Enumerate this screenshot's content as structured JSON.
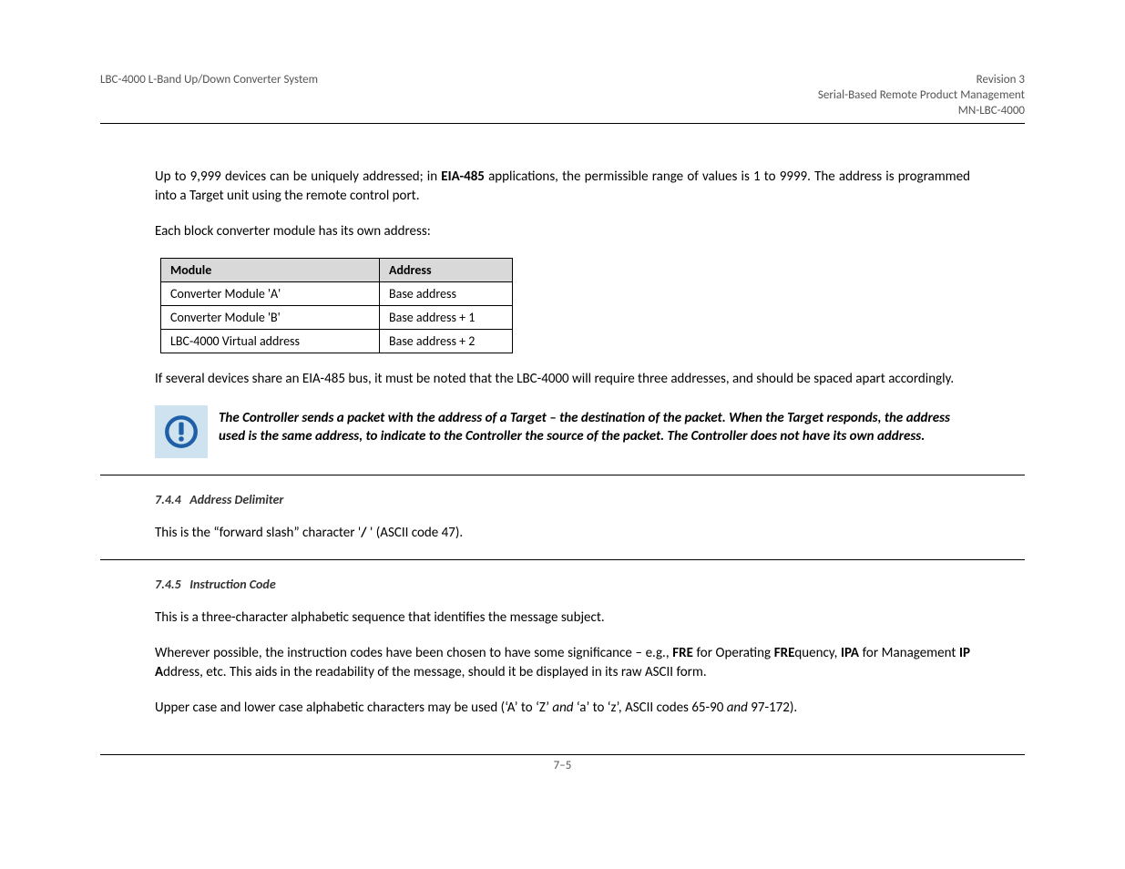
{
  "header": {
    "left": "LBC-4000 L-Band Up/Down Converter System",
    "right_line1": "Revision 3",
    "right_line2": "Serial-Based Remote Product Management",
    "right_line3": "MN-LBC-4000"
  },
  "sec_target": {
    "p1_a": "Up to 9,999 devices can be uniquely addressed; in ",
    "p1_b1": "EIA-485",
    "p1_c": " applications, the permissible range of values is 1 to 9999. The address is programmed into a Target unit using the remote control port.",
    "p2": "Each block converter module has its own address:",
    "table": {
      "h1": "Module",
      "h2": "Address",
      "rows": [
        {
          "c1": "Converter Module 'A'",
          "c2": "Base address"
        },
        {
          "c1": "Converter Module 'B'",
          "c2": "Base address + 1"
        },
        {
          "c1": "LBC-4000 Virtual address",
          "c2": "Base address + 2"
        }
      ]
    },
    "p3": "If several devices share an EIA-485 bus, it must be noted that the LBC-4000 will require three addresses, and should be spaced apart accordingly.",
    "note": "The Controller sends a packet with the address of a Target – the destination of the packet. When the Target responds, the address used is the same address, to indicate to the Controller the source of the packet. The Controller does not have its own address."
  },
  "sec_delim": {
    "num": "7.4.4",
    "title": "Address Delimiter",
    "p1": "This is the “forward slash” character ' / ' (ASCII code 47)."
  },
  "sec_instr": {
    "num": "7.4.5",
    "title": "Instruction Code",
    "p1": "This is a three-character alphabetic sequence that identifies the message subject.",
    "p2_a": "Wherever possible, the instruction codes have been chosen to have some significance – e.g., ",
    "p2_b1": "FRE",
    "p2_c": " for Operating ",
    "p2_b2": "FRE",
    "p2_d": "quency, ",
    "p2_b3": "IPA",
    "p2_e": " for Management ",
    "p2_b4": "IP A",
    "p2_f": "ddress, etc. This aids in the readability of the message, should it be displayed in its raw ASCII form.",
    "p3_a": "Upper case and lower case alphabetic characters may be used (‘A’ to ‘Z’ ",
    "p3_i1": "and",
    "p3_b": " ‘a’ to ‘z’, ASCII codes 65-90 ",
    "p3_i2": "and",
    "p3_c": " 97-172)."
  },
  "footer": "7–5"
}
